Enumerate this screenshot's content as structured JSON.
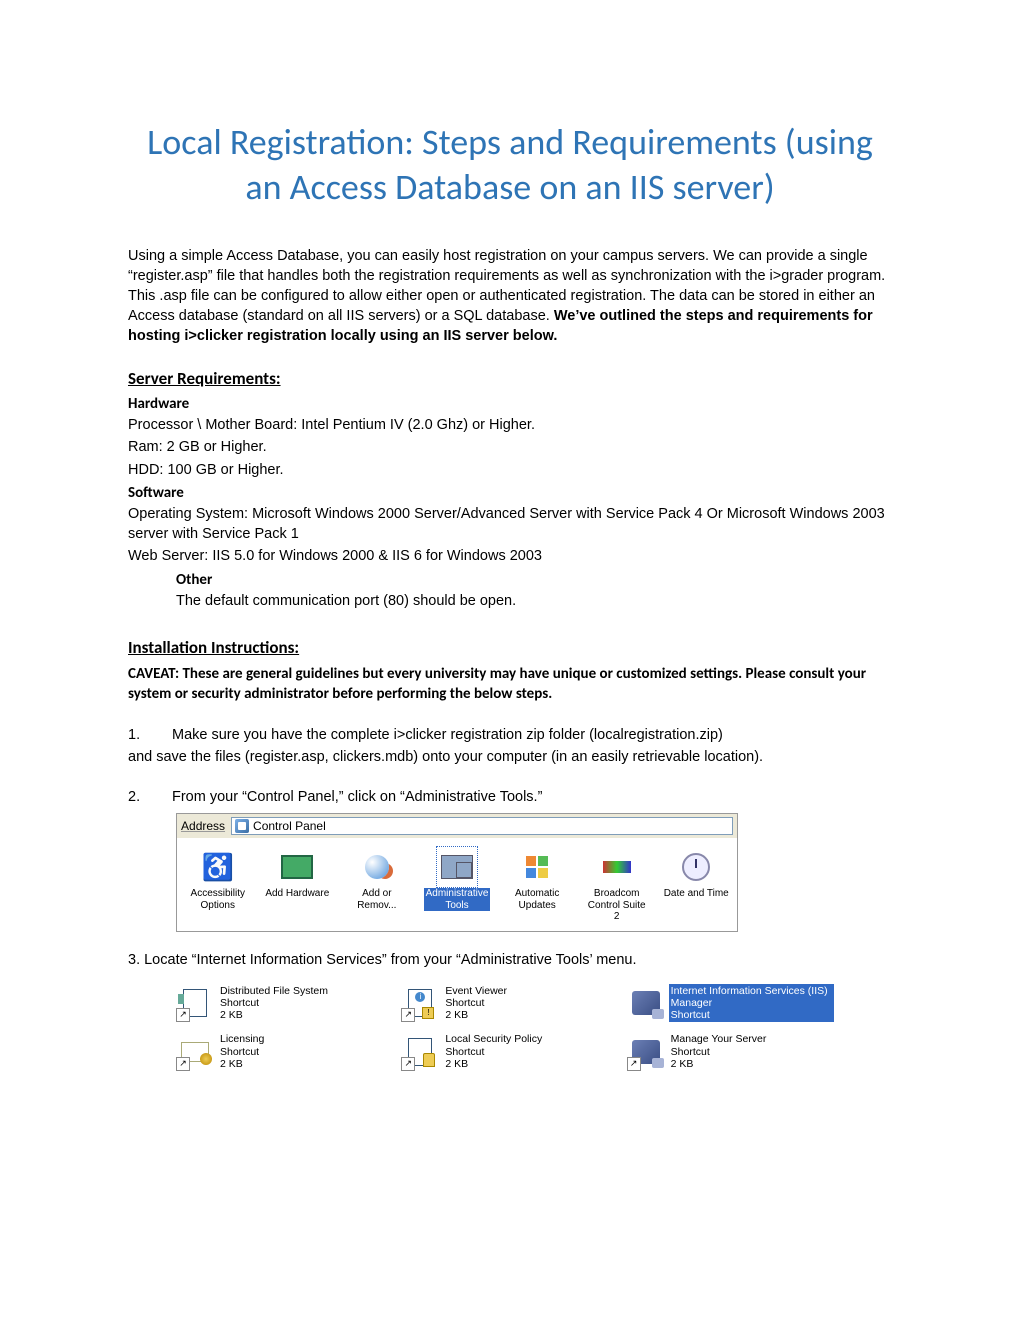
{
  "title": "Local Registration: Steps and Requirements (using an Access Database on an IIS server)",
  "intro_plain": "Using a simple Access Database, you can easily host registration on your campus servers. We can provide a single “register.asp” file that handles both the registration requirements as well as synchronization with the i>grader program.  This .asp file can be configured to allow either open or authenticated registration. The data can be stored in either an Access database (standard on all IIS servers) or a SQL database. ",
  "intro_bold": "We’ve outlined the steps and requirements for hosting i>clicker registration locally using an IIS server below.",
  "req_head": "Server Requirements:",
  "hw_head": "Hardware",
  "hw1": "Processor \\ Mother Board: Intel Pentium IV (2.0 Ghz) or Higher.",
  "hw2": "Ram: 2 GB or Higher.",
  "hw3": "HDD: 100 GB or Higher.",
  "sw_head": "Software",
  "sw1": "Operating System: Microsoft Windows 2000 Server/Advanced Server with Service Pack 4 Or Microsoft Windows 2003 server with Service Pack 1",
  "sw2": "Web Server: IIS 5.0 for Windows 2000 & IIS 6 for Windows 2003",
  "other_head": "Other",
  "other1": "The default communication port (80) should be open.",
  "inst_head": "Installation Instructions:",
  "caveat": "CAVEAT: These are general guidelines but every university may have unique or customized settings. Please consult your system or security administrator before performing the below steps.",
  "step1a": "Make sure you have the complete i>clicker registration zip folder (localregistration.zip)",
  "step1b": "and save the files (register.asp, clickers.mdb) onto your computer (in an easily retrievable location).",
  "step2": "From your “Control Panel,” click on “Administrative Tools.”",
  "step3": "3. Locate “Internet Information Services” from your “Administrative Tools’ menu.",
  "cp": {
    "addr_label": "Address",
    "addr_value": "Control Panel",
    "items": [
      {
        "label": "Accessibility Options"
      },
      {
        "label": "Add Hardware"
      },
      {
        "label": "Add or Remov..."
      },
      {
        "label": "Administrative Tools"
      },
      {
        "label": "Automatic Updates"
      },
      {
        "label": "Broadcom Control Suite 2"
      },
      {
        "label": "Date and Time"
      }
    ]
  },
  "at": {
    "shortcut": "Shortcut",
    "size": "2 KB",
    "items": [
      {
        "title": "Distributed File System"
      },
      {
        "title": "Event Viewer"
      },
      {
        "title": "Internet Information Services (IIS) Manager"
      },
      {
        "title": "Licensing"
      },
      {
        "title": "Local Security Policy"
      },
      {
        "title": "Manage Your Server"
      }
    ]
  }
}
